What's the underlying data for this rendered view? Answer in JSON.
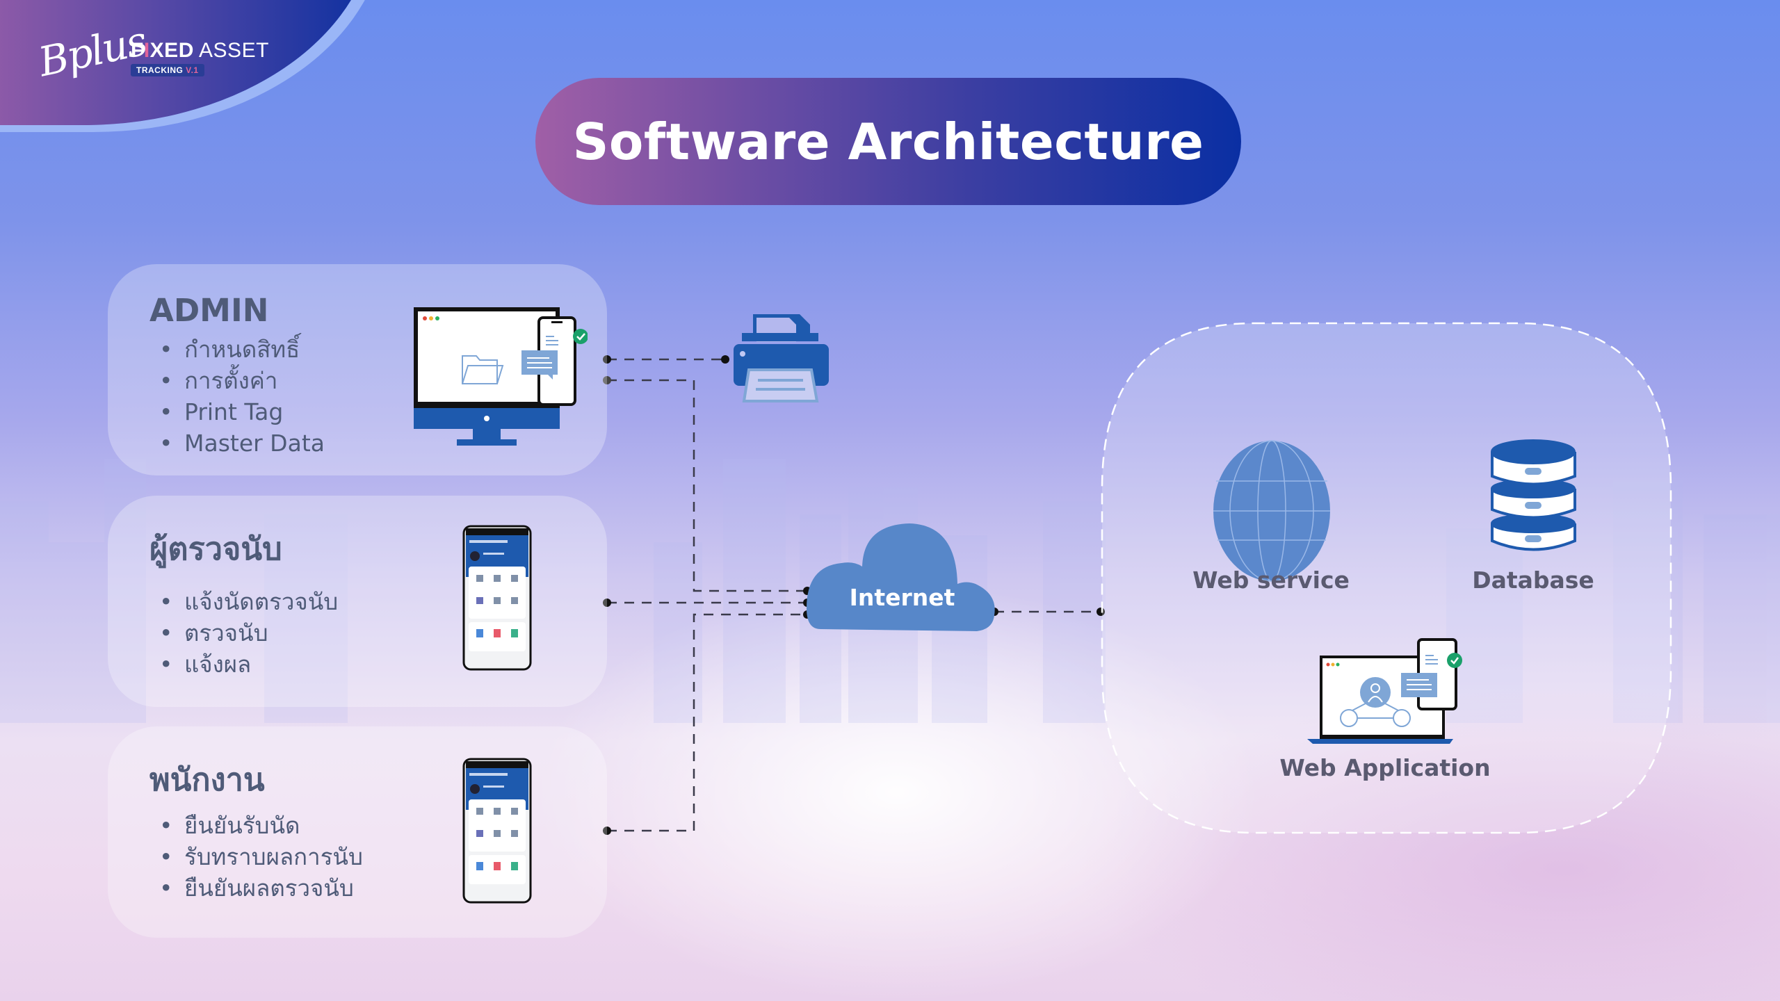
{
  "brand": {
    "script_name": "Bplus",
    "product_prefix": "F",
    "product_accent_letter": "I",
    "product_rest_bold": "XED",
    "product_rest": " ASSET",
    "subtitle": "TRACKING",
    "version": "V.1",
    "accent_color": "#e0649a"
  },
  "title": "Software Architecture",
  "roles": [
    {
      "heading": "ADMIN",
      "device": "desktop-with-phone",
      "items": [
        "กำหนดสิทธิ์",
        "การตั้งค่า",
        "Print Tag",
        "Master Data"
      ]
    },
    {
      "heading": "ผู้ตรวจนับ",
      "device": "mobile-app",
      "items": [
        "แจ้งนัดตรวจนับ",
        "ตรวจนับ",
        "แจ้งผล"
      ]
    },
    {
      "heading": "พนักงาน",
      "device": "mobile-app",
      "items": [
        "ยืนยันรับนัด",
        "รับทราบผลการนับ",
        "ยืนยันผลตรวจนับ"
      ]
    }
  ],
  "nodes": {
    "printer": "printer-icon",
    "internet": "Internet",
    "web_service": "Web service",
    "database": "Database",
    "web_application": "Web Application"
  },
  "connections": [
    {
      "from": "ADMIN",
      "to": "printer"
    },
    {
      "from": "ADMIN",
      "to": "Internet"
    },
    {
      "from": "ผู้ตรวจนับ",
      "to": "Internet"
    },
    {
      "from": "พนักงาน",
      "to": "Internet"
    },
    {
      "from": "Internet",
      "to": "server-cluster"
    }
  ],
  "colors": {
    "primary_blue": "#1e5aae",
    "cloud_blue": "#5787c9",
    "text_slate": "#4f5b78",
    "check_green": "#1aa06a"
  }
}
